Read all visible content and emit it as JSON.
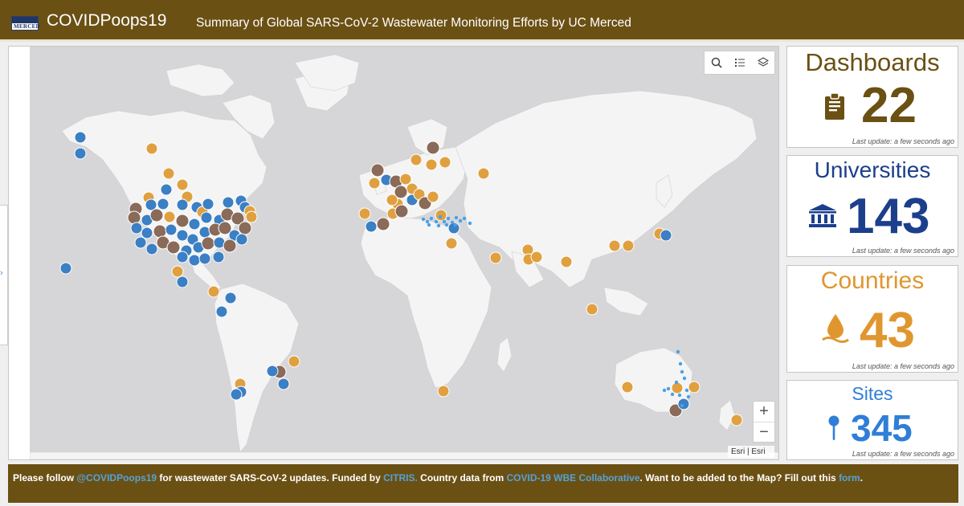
{
  "header": {
    "logo_text": "MERCED",
    "title": "COVIDPoops19",
    "subtitle": "Summary of Global SARS-CoV-2 Wastewater Monitoring Efforts by UC Merced"
  },
  "map": {
    "attribution": "Esri | Esri",
    "zoom_in": "+",
    "zoom_out": "−",
    "tools": [
      "search-icon",
      "legend-icon",
      "layers-icon"
    ]
  },
  "cards": {
    "dashboards": {
      "title": "Dashboards",
      "value": "22",
      "updated": "Last update: a few seconds ago",
      "color": "#6b5014",
      "icon": "clipboard-icon"
    },
    "universities": {
      "title": "Universities",
      "value": "143",
      "updated": "Last update: a few seconds ago",
      "color": "#1c3f8c",
      "icon": "university-icon"
    },
    "countries": {
      "title": "Countries",
      "value": "43",
      "updated": "Last update: a few seconds ago",
      "color": "#e0962f",
      "icon": "water-drop-icon"
    },
    "sites": {
      "title": "Sites",
      "value": "345",
      "updated": "Last update: a few seconds ago",
      "color": "#2f7ed8",
      "icon": "map-pin-icon"
    }
  },
  "footer": {
    "t1": "Please follow ",
    "l1": "@COVIDPoops19",
    "t2": " for wastewater SARS-CoV-2 updates. Funded by ",
    "l2": "CITRIS.",
    "t3": " Country data from ",
    "l3": "COVID-19 WBE Collaborative",
    "t4": ". Want to be added to the Map? Fill out this ",
    "l4": "form",
    "t5": "."
  },
  "legend_colors": {
    "country": "#e0a040",
    "university": "#3b7fc4",
    "dashboard": "#8a6a58",
    "site": "#4aa0e8"
  }
}
